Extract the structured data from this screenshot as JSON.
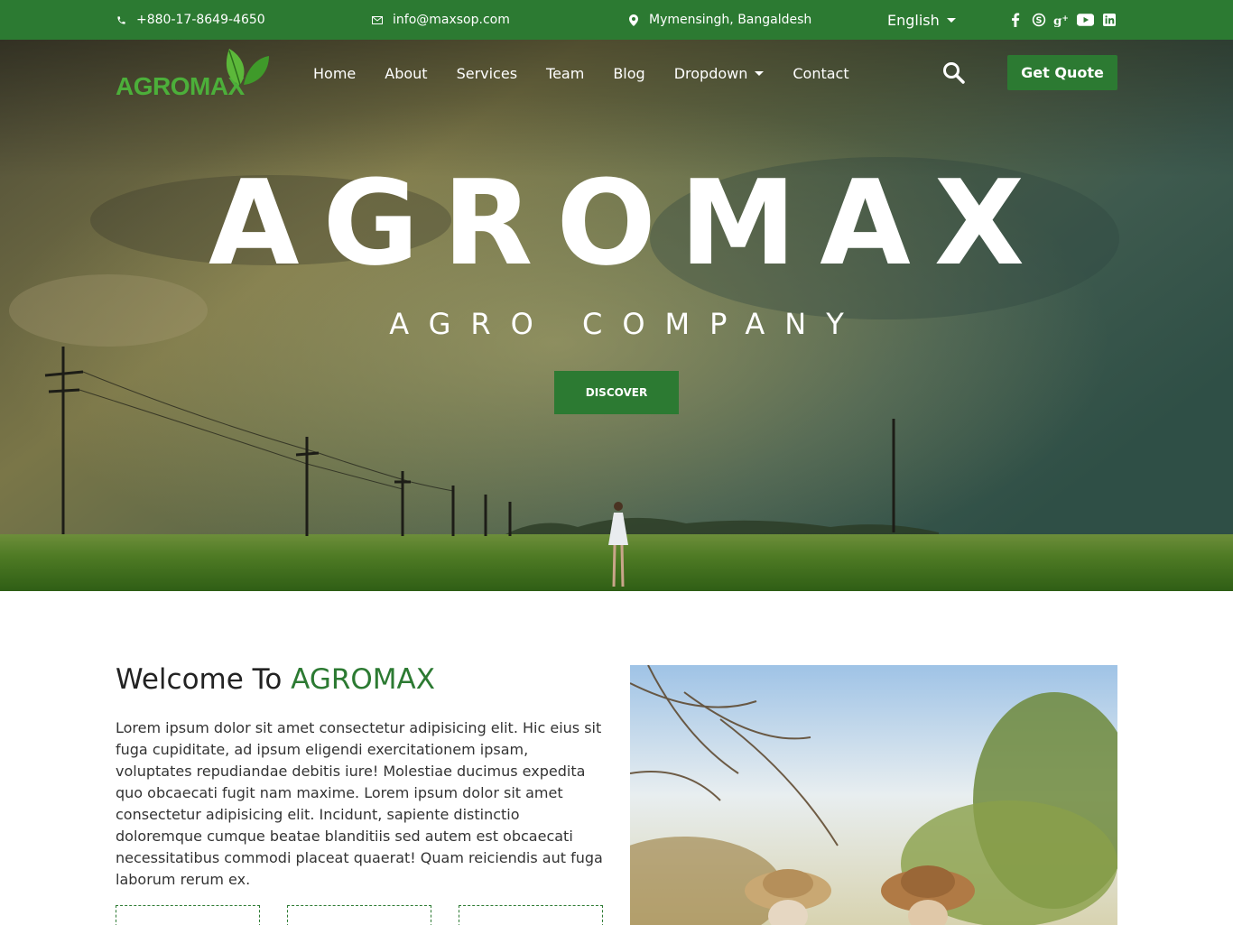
{
  "topbar": {
    "phone": "+880-17-8649-4650",
    "email": "info@maxsop.com",
    "location": "Mymensingh, Bangaldesh",
    "language": "English",
    "socials": [
      "facebook-icon",
      "skype-icon",
      "google-plus-icon",
      "youtube-icon",
      "linkedin-icon"
    ]
  },
  "brand": {
    "logo_text": "AGROMAX",
    "primary_color": "#2c7a32",
    "logo_color": "#4caf3a"
  },
  "nav": {
    "items": [
      {
        "label": "Home"
      },
      {
        "label": "About"
      },
      {
        "label": "Services"
      },
      {
        "label": "Team"
      },
      {
        "label": "Blog"
      },
      {
        "label": "Dropdown"
      },
      {
        "label": "Contact"
      }
    ],
    "search_icon": "search-icon",
    "quote_label": "Get Quote"
  },
  "hero": {
    "title": "AGROMAX",
    "subtitle": "AGRO COMPANY",
    "button_label": "DISCOVER"
  },
  "welcome": {
    "title_prefix": "Welcome To ",
    "title_brand": "AGROMAX",
    "text": "Lorem ipsum dolor sit amet consectetur adipisicing elit. Hic eius sit fuga cupiditate, ad ipsum eligendi exercitationem ipsam, voluptates repudiandae debitis iure! Molestiae ducimus expedita quo obcaecati fugit nam maxime. Lorem ipsum dolor sit amet consectetur adipisicing elit. Incidunt, sapiente distinctio doloremque cumque beatae blanditiis sed autem est obcaecati necessitatibus commodi placeat quaerat! Quam reiciendis aut fuga laborum rerum ex."
  }
}
